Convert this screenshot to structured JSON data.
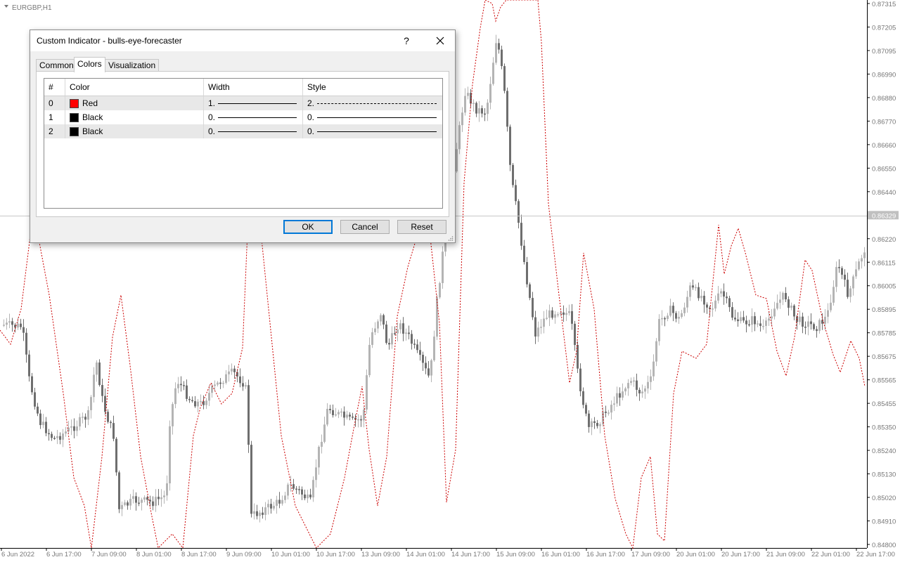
{
  "chart": {
    "symbol_label": "EURGBP,H1",
    "price_levels": [
      "0.87315",
      "0.87205",
      "0.87095",
      "0.86990",
      "0.86880",
      "0.86770",
      "0.86660",
      "0.86550",
      "0.86440",
      "0.86329",
      "0.86220",
      "0.86115",
      "0.86005",
      "0.85895",
      "0.85785",
      "0.85675",
      "0.85565",
      "0.85455",
      "0.85350",
      "0.85240",
      "0.85130",
      "0.85020",
      "0.84910",
      "0.84800"
    ],
    "current_price": "0.86329",
    "time_labels": [
      "6 Jun 2022",
      "6 Jun 17:00",
      "7 Jun 09:00",
      "8 Jun 01:00",
      "8 Jun 17:00",
      "9 Jun 09:00",
      "10 Jun 01:00",
      "10 Jun 17:00",
      "13 Jun 09:00",
      "14 Jun 01:00",
      "14 Jun 17:00",
      "15 Jun 09:00",
      "16 Jun 01:00",
      "16 Jun 17:00",
      "17 Jun 09:00",
      "20 Jun 01:00",
      "20 Jun 17:00",
      "21 Jun 09:00",
      "22 Jun 01:00",
      "22 Jun 17:00"
    ],
    "colors": {
      "candle_bull": "#b4b4b4",
      "candle_bear": "#6e6e6e",
      "indicator": "#cc0000",
      "price_line": "#c0c0c0"
    }
  },
  "dialog": {
    "title": "Custom Indicator - bulls-eye-forecaster",
    "help_label": "?",
    "tabs": [
      {
        "label": "Common",
        "active": false
      },
      {
        "label": "Colors",
        "active": true
      },
      {
        "label": "Visualization",
        "active": false
      }
    ],
    "columns": [
      "#",
      "Color",
      "Width",
      "Style"
    ],
    "rows": [
      {
        "index": "0",
        "color_name": "Red",
        "swatch": "#ff0000",
        "width": "1.",
        "style": "2.",
        "style_dashed": true
      },
      {
        "index": "1",
        "color_name": "Black",
        "swatch": "#000000",
        "width": "0.",
        "style": "0.",
        "style_dashed": false
      },
      {
        "index": "2",
        "color_name": "Black",
        "swatch": "#000000",
        "width": "0.",
        "style": "0.",
        "style_dashed": false
      }
    ],
    "buttons": {
      "ok": "OK",
      "cancel": "Cancel",
      "reset": "Reset"
    }
  }
}
